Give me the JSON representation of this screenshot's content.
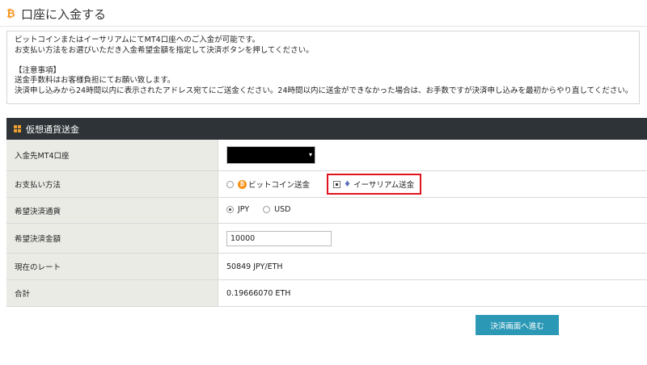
{
  "header": {
    "title": "口座に入金する",
    "icon": "bitcoin-icon"
  },
  "notice": {
    "line1": "ビットコインまたはイーサリアムにてMT4口座へのご入金が可能です。",
    "line2": "お支払い方法をお選びいただき入金希望金額を指定して決済ボタンを押してください。",
    "heading": "【注意事項】",
    "line3": "送金手数料はお客様負担にてお願い致します。",
    "line4": "決済申し込みから24時間以内に表示されたアドレス宛てにご送金ください。24時間以内に送金ができなかった場合は、お手数ですが決済申し込みを最初からやり直してください。"
  },
  "panel": {
    "title": "仮想通貨送金",
    "icon": "grid-icon"
  },
  "form": {
    "account_label": "入金先MT4口座",
    "payment_label": "お支払い方法",
    "payment_btc": "ビットコイン送金",
    "payment_eth": "イーサリアム送金",
    "currency_label": "希望決済通貨",
    "currency_jpy": "JPY",
    "currency_usd": "USD",
    "amount_label": "希望決済金額",
    "amount_value": "10000",
    "rate_label": "現在のレート",
    "rate_value": "50849 JPY/ETH",
    "total_label": "合計",
    "total_value": "0.19666070 ETH"
  },
  "submit": {
    "label": "決済画面へ進む"
  },
  "colors": {
    "accent": "#2b98b6",
    "panel_header": "#2d3336",
    "highlight": "#e0141e",
    "bitcoin": "#f7931a"
  }
}
